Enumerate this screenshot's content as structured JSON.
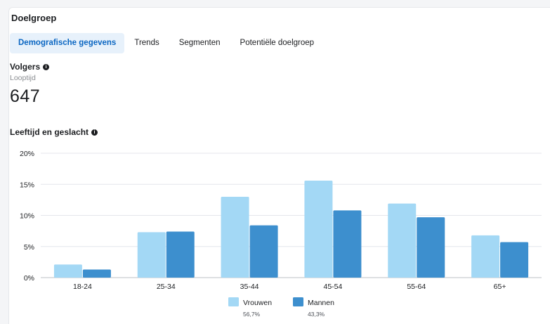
{
  "header": {
    "title": "Doelgroep"
  },
  "tabs": [
    {
      "label": "Demografische gegevens",
      "active": true
    },
    {
      "label": "Trends",
      "active": false
    },
    {
      "label": "Segmenten",
      "active": false
    },
    {
      "label": "Potentiële doelgroep",
      "active": false
    }
  ],
  "followers": {
    "title": "Volgers",
    "info_icon": "info-icon",
    "sublabel": "Looptijd",
    "value": "647"
  },
  "age_gender": {
    "title": "Leeftijd en geslacht",
    "info_icon": "info-icon"
  },
  "colors": {
    "women": "#a3d8f5",
    "men": "#3d8fce",
    "grid": "#e4e6eb",
    "accent": "#0a66c2"
  },
  "chart_data": {
    "type": "bar",
    "title": "Leeftijd en geslacht",
    "xlabel": "",
    "ylabel": "",
    "ylim": [
      0,
      20
    ],
    "yticks": [
      "0%",
      "5%",
      "10%",
      "15%",
      "20%"
    ],
    "ytick_values": [
      0,
      5,
      10,
      15,
      20
    ],
    "grid": true,
    "legend_position": "bottom",
    "categories": [
      "18-24",
      "25-34",
      "35-44",
      "45-54",
      "55-64",
      "65+"
    ],
    "series": [
      {
        "name": "Vrouwen",
        "share": "56,7%",
        "values": [
          2.1,
          7.3,
          13.0,
          15.6,
          11.9,
          6.8
        ]
      },
      {
        "name": "Mannen",
        "share": "43,3%",
        "values": [
          1.3,
          7.4,
          8.4,
          10.8,
          9.7,
          5.7
        ]
      }
    ]
  }
}
